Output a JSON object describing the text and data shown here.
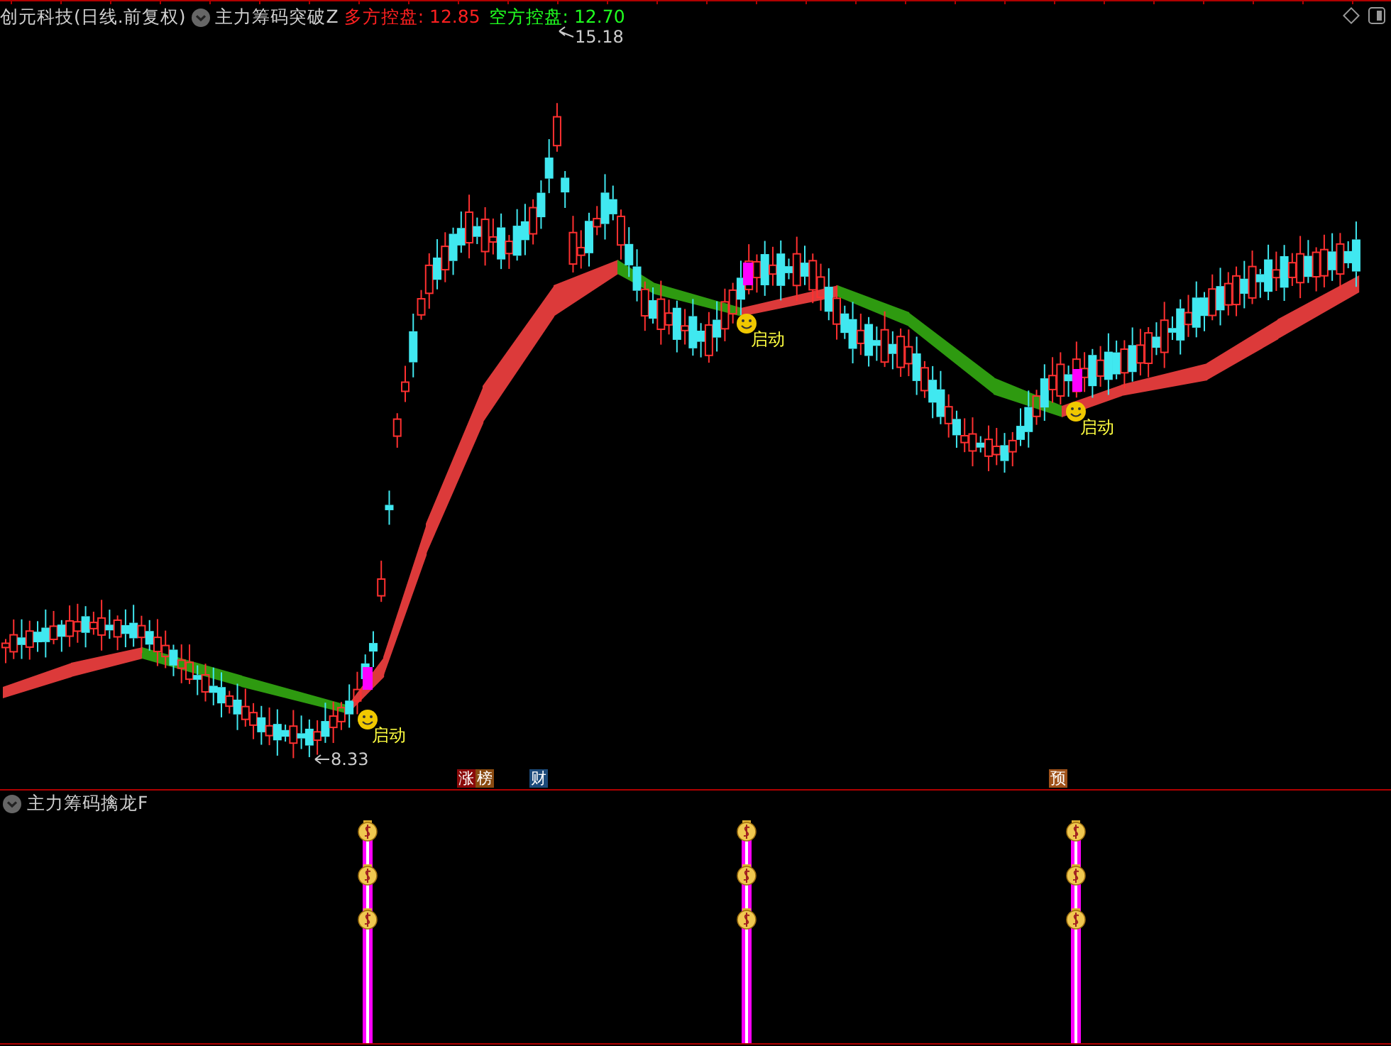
{
  "header": {
    "stock": "创元科技(日线.前复权)",
    "indicator": "主力筹码突破Z",
    "readouts": [
      {
        "label": "多方控盘:",
        "value": "12.85",
        "color": "#ff2020"
      },
      {
        "label": "空方控盘:",
        "value": "12.70",
        "color": "#20ff20"
      }
    ]
  },
  "price_labels": [
    {
      "kind": "high",
      "text": "15.18"
    },
    {
      "kind": "low",
      "text": "8.33"
    }
  ],
  "signals": [
    {
      "label": "启动"
    },
    {
      "label": "启动"
    },
    {
      "label": "启动"
    }
  ],
  "badges": [
    {
      "text": "涨",
      "color": "#8b0a0a"
    },
    {
      "text": "榜",
      "color": "#8a4a10"
    },
    {
      "text": "财",
      "color": "#1c4a7a"
    },
    {
      "text": "预",
      "color": "#a0521a"
    }
  ],
  "lower_panel": {
    "title": "主力筹码擒龙F"
  }
}
